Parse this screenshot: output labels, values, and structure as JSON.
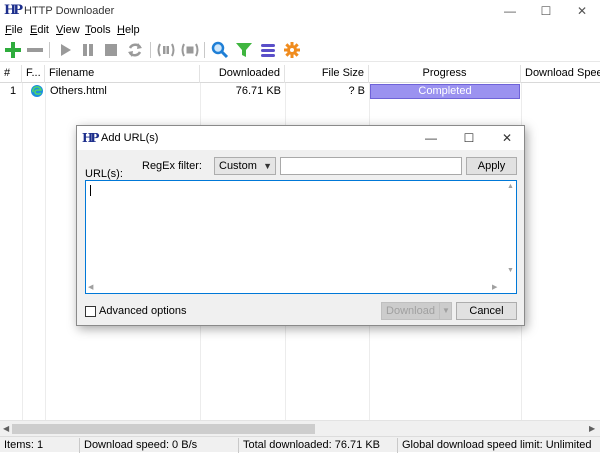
{
  "app": {
    "title": "HTTP Downloader",
    "logo": "HP"
  },
  "window_controls": {
    "minimize": "—",
    "maximize": "☐",
    "close": "✕"
  },
  "menu": [
    {
      "label": "File",
      "u": "F",
      "rest": "ile"
    },
    {
      "label": "Edit",
      "u": "E",
      "rest": "dit"
    },
    {
      "label": "View",
      "u": "V",
      "rest": "iew"
    },
    {
      "label": "Tools",
      "u": "T",
      "rest": "ools"
    },
    {
      "label": "Help",
      "u": "H",
      "rest": "elp"
    }
  ],
  "toolbar_icons": [
    "add-icon",
    "remove-icon",
    "start-icon",
    "pause-icon",
    "stop-icon",
    "restart-icon",
    "pause-active-icon",
    "stop-active-icon",
    "search-icon",
    "filter-icon",
    "queue-icon",
    "settings-icon"
  ],
  "columns": [
    "#",
    "F...",
    "Filename",
    "Downloaded",
    "File Size",
    "Progress",
    "Download Speed"
  ],
  "rows": [
    {
      "num": "1",
      "filename": "Others.html",
      "downloaded": "76.71 KB",
      "size": "? B",
      "progress": "Completed",
      "progress_value": 1.0
    }
  ],
  "status": {
    "items": "Items: 1",
    "speed": "Download speed: 0 B/s",
    "total": "Total downloaded: 76.71 KB",
    "limit": "Global download speed limit: Unlimited"
  },
  "dialog": {
    "title": "Add URL(s)",
    "logo": "HP",
    "regex_label": "RegEx filter:",
    "regex_mode": "Custom",
    "regex_value": "",
    "apply_label": "Apply",
    "urls_label": "URL(s):",
    "urls_value": "",
    "advanced_label": "Advanced options",
    "download_label": "Download",
    "cancel_label": "Cancel"
  },
  "colors": {
    "progress_fill": "#9b92f0",
    "accent_border": "#0078d7",
    "add_green": "#2eac3c",
    "logo_blue": "#1c2e8c"
  }
}
